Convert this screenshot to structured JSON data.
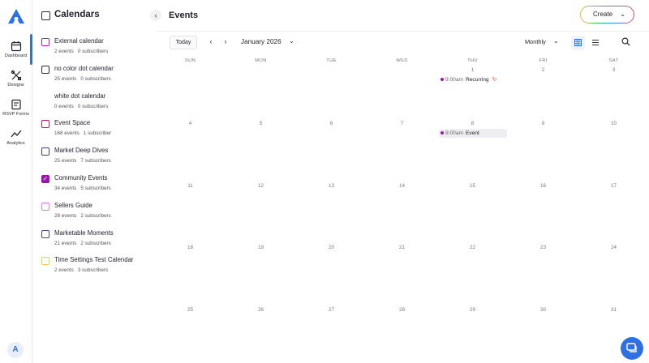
{
  "nav": {
    "items": [
      {
        "label": "Dashboard",
        "icon": "calendar-icon"
      },
      {
        "label": "Designs",
        "icon": "designs-icon"
      },
      {
        "label": "RSVP Forms",
        "icon": "form-icon"
      },
      {
        "label": "Analytics",
        "icon": "analytics-icon"
      }
    ],
    "avatar": "A"
  },
  "calendars": {
    "title": "Calendars",
    "items": [
      {
        "name": "External calendar",
        "events": "2 events",
        "subs": "0 subscribers",
        "color": "#b21fb6",
        "checked": false
      },
      {
        "name": "no color dot calendar",
        "events": "25 events",
        "subs": "0 subscribers",
        "color": "#2a2a38",
        "checked": false
      },
      {
        "name": "white dot calendar",
        "events": "0 events",
        "subs": "0 subscribers",
        "color": "#ffffff",
        "checked": false
      },
      {
        "name": "Event Space",
        "events": "168 events",
        "subs": "1 subscriber",
        "color": "#c2185b",
        "checked": false
      },
      {
        "name": "Market Deep Dives",
        "events": "25 events",
        "subs": "7 subscribers",
        "color": "#3b3f7a",
        "checked": false
      },
      {
        "name": "Community Events",
        "events": "34 events",
        "subs": "5 subscribers",
        "color": "#a012b0",
        "checked": true
      },
      {
        "name": "Sellers Guide",
        "events": "28 events",
        "subs": "2 subscribers",
        "color": "#e27ad9",
        "checked": false
      },
      {
        "name": "Marketable Moments",
        "events": "21 events",
        "subs": "2 subscribers",
        "color": "#5a3d7a",
        "checked": false
      },
      {
        "name": "Time Settings Test Calendar",
        "events": "2 events",
        "subs": "3 subscribers",
        "color": "#f2cf4b",
        "checked": false
      }
    ]
  },
  "main": {
    "title": "Events",
    "create_label": "Create",
    "today_label": "Today",
    "month_label": "January 2026",
    "view_label": "Monthly",
    "weekdays": [
      "SUN",
      "MON",
      "TUE",
      "WED",
      "THU",
      "FRI",
      "SAT"
    ],
    "weeks": [
      [
        "",
        "",
        "",
        "",
        "1",
        "2",
        "3"
      ],
      [
        "4",
        "5",
        "6",
        "7",
        "8",
        "9",
        "10"
      ],
      [
        "11",
        "12",
        "13",
        "14",
        "15",
        "16",
        "17"
      ],
      [
        "18",
        "19",
        "20",
        "21",
        "22",
        "23",
        "24"
      ],
      [
        "25",
        "26",
        "27",
        "28",
        "29",
        "30",
        "31"
      ]
    ],
    "events": [
      {
        "time": "9:00am",
        "title": "Recurring",
        "day": "1",
        "recurring": true
      },
      {
        "time": "9:00am",
        "title": "Event",
        "day": "8",
        "recurring": false
      }
    ]
  },
  "colors": {
    "accent": "#2f6fe4",
    "event_dot": "#a012b0"
  }
}
